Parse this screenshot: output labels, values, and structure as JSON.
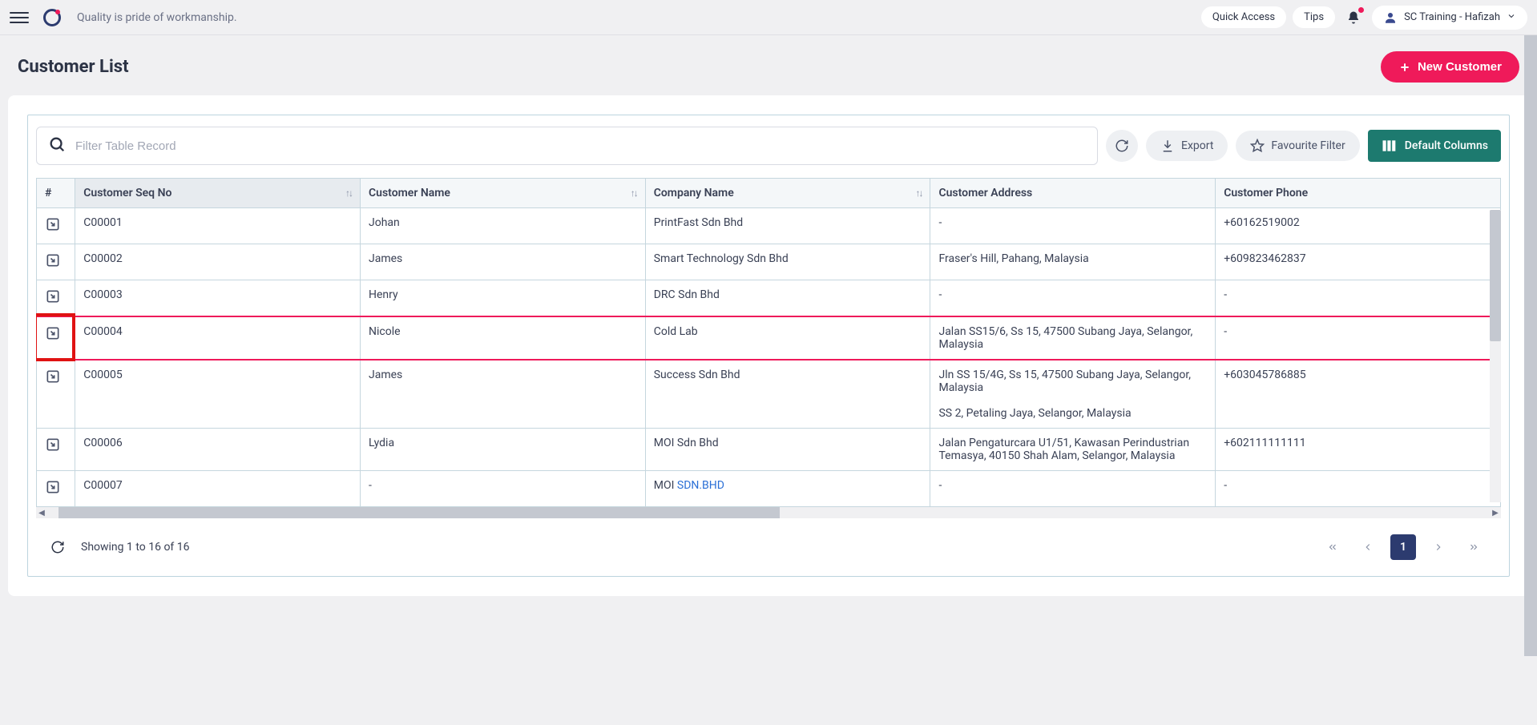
{
  "app": {
    "tagline": "Quality is pride of workmanship.",
    "quick_access": "Quick Access",
    "tips": "Tips",
    "user_label": "SC Training - Hafizah"
  },
  "page": {
    "title": "Customer List",
    "new_button": "New Customer"
  },
  "toolbar": {
    "search_placeholder": "Filter Table Record",
    "export": "Export",
    "favourite": "Favourite Filter",
    "default_cols": "Default Columns"
  },
  "columns": {
    "hash": "#",
    "seq": "Customer Seq No",
    "name": "Customer Name",
    "company": "Company Name",
    "address": "Customer Address",
    "phone": "Customer Phone"
  },
  "rows": [
    {
      "seq": "C00001",
      "name": "Johan",
      "company": "PrintFast Sdn Bhd",
      "address": "-",
      "phone": "+60162519002"
    },
    {
      "seq": "C00002",
      "name": "James",
      "company": "Smart Technology Sdn Bhd",
      "address": "Fraser's Hill, Pahang, Malaysia",
      "phone": "+609823462837"
    },
    {
      "seq": "C00003",
      "name": "Henry",
      "company": "DRC Sdn Bhd",
      "address": "-",
      "phone": "-"
    },
    {
      "seq": "C00004",
      "name": "Nicole",
      "company": "Cold Lab",
      "address": "Jalan SS15/6, Ss 15, 47500 Subang Jaya, Selangor, Malaysia",
      "phone": "-"
    },
    {
      "seq": "C00005",
      "name": "James",
      "company": "Success Sdn Bhd",
      "address": "Jln SS 15/4G, Ss 15, 47500 Subang Jaya, Selangor, Malaysia\n\nSS 2, Petaling Jaya, Selangor, Malaysia",
      "phone": "+603045786885"
    },
    {
      "seq": "C00006",
      "name": "Lydia",
      "company": "MOI Sdn Bhd",
      "address": "Jalan Pengaturcara U1/51, Kawasan Perindustrian Temasya, 40150 Shah Alam, Selangor, Malaysia",
      "phone": "+602111111111"
    },
    {
      "seq": "C00007",
      "name": "-",
      "company_pre": "MOI ",
      "company_link": "SDN.BHD",
      "address": "-",
      "phone": "-"
    }
  ],
  "footer": {
    "info": "Showing 1 to 16 of 16",
    "page": "1"
  },
  "colors": {
    "accent": "#ef1a5a",
    "teal": "#1d7a6f",
    "red_highlight": "#e01313"
  }
}
